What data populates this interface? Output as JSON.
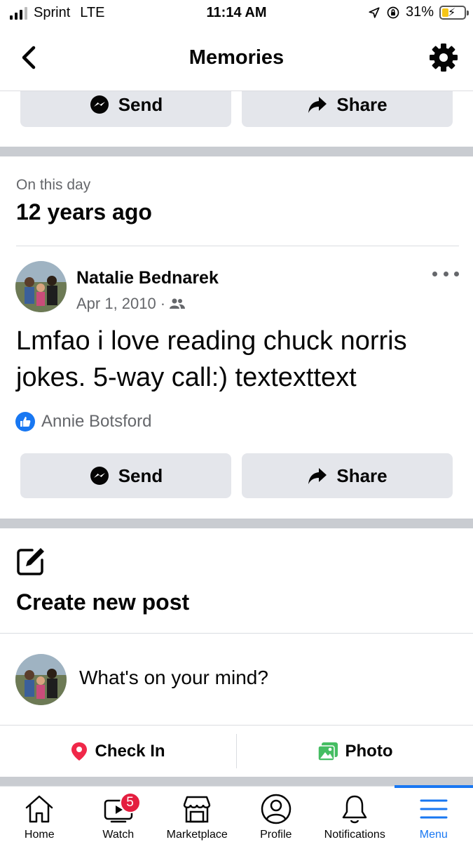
{
  "status_bar": {
    "carrier": "Sprint",
    "network": "LTE",
    "time": "11:14 AM",
    "battery": "31%",
    "battery_level": 0.31
  },
  "header": {
    "title": "Memories",
    "back_icon": "chevron-left-icon",
    "settings_icon": "gear-icon"
  },
  "top_actions": {
    "send_label": "Send",
    "share_label": "Share"
  },
  "memory": {
    "label": "On this day",
    "years_ago": "12 years ago",
    "post": {
      "author": "Natalie Bednarek",
      "date": "Apr 1, 2010",
      "separator": "·",
      "audience_icon": "friends-icon",
      "text": "Lmfao i love reading chuck norris jokes. 5-way call:) textexttext",
      "reaction_user": "Annie Botsford"
    },
    "send_label": "Send",
    "share_label": "Share"
  },
  "create_post": {
    "title": "Create new post",
    "placeholder": "What's on your mind?",
    "check_in_label": "Check In",
    "photo_label": "Photo"
  },
  "tab_bar": {
    "tabs": [
      {
        "label": "Home",
        "icon": "home-icon"
      },
      {
        "label": "Watch",
        "icon": "watch-icon",
        "badge": "5"
      },
      {
        "label": "Marketplace",
        "icon": "marketplace-icon"
      },
      {
        "label": "Profile",
        "icon": "profile-icon"
      },
      {
        "label": "Notifications",
        "icon": "bell-icon"
      },
      {
        "label": "Menu",
        "icon": "menu-icon",
        "active": true
      }
    ]
  },
  "colors": {
    "brand_blue": "#1877f2",
    "button_gray": "#e4e6eb",
    "badge_red": "#e41e3f",
    "secondary_text": "#65676b"
  }
}
